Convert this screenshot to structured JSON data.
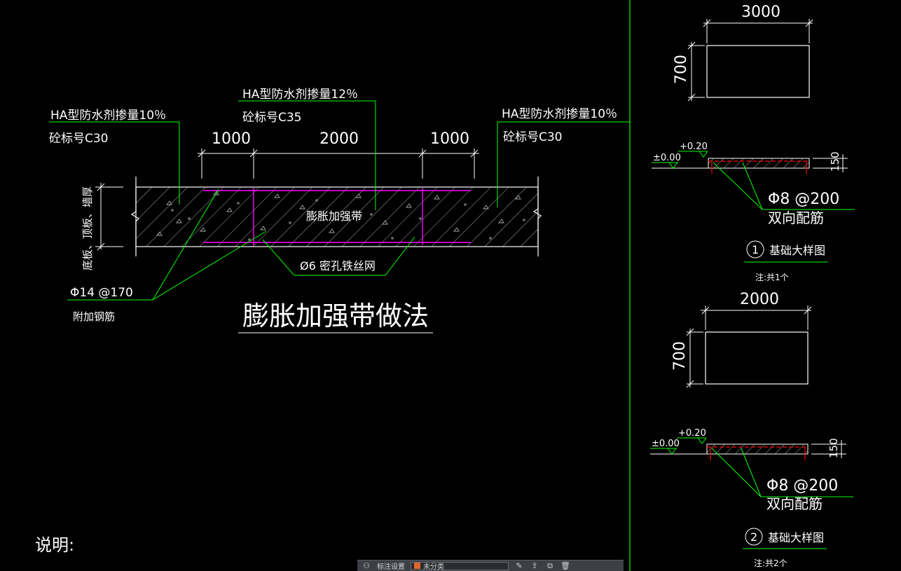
{
  "colors": {
    "background": "#000000",
    "line_white": "#ffffff",
    "leader_green": "#00ff00",
    "rebar_magenta": "#ff00ff",
    "rebar_red": "#ff0000",
    "hatch_gray": "#a8a8a8"
  },
  "main_detail": {
    "title": "膨胀加强带做法",
    "left_note": {
      "line1": "HA型防水剂掺量10％",
      "line2": "砼标号C30"
    },
    "center_note": {
      "line1": "HA型防水剂掺量12％",
      "line2": "砼标号C35"
    },
    "right_note": {
      "line1": "HA型防水剂掺量10％",
      "line2": "砼标号C30"
    },
    "dimensions": [
      "1000",
      "2000",
      "1000"
    ],
    "band_label": "膨胀加强带",
    "thickness_label": "底板、顶板、墙厚",
    "mesh_label": "Ø6 密孔铁丝网",
    "rebar_label": {
      "line1": "Φ14 @170",
      "line2": "附加钢筋"
    }
  },
  "notes_heading": "说明:",
  "detail_1": {
    "plan_width": "3000",
    "plan_height": "700",
    "level_low": "±0.00",
    "level_high": "+0.20",
    "thickness": "150",
    "rebar": "Φ8 @200",
    "rebar_note": "双向配筋",
    "number": "1",
    "title": "基础大样图",
    "note": "注:共1个"
  },
  "detail_2": {
    "plan_width": "2000",
    "plan_height": "700",
    "level_low": "±0.00",
    "level_high": "+0.20",
    "thickness": "150",
    "rebar": "Φ8 @200",
    "rebar_note": "双向配筋",
    "number": "2",
    "title": "基础大样图",
    "note": "注:共2个"
  },
  "toolbar": {
    "layer_label": "标注设置",
    "layer_value": "未分类"
  }
}
